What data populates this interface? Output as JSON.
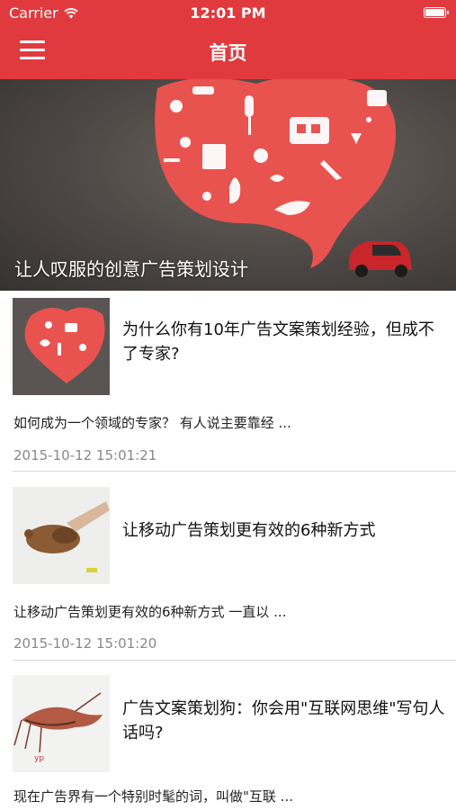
{
  "status_bar": {
    "carrier": "Carrier",
    "time": "12:01 PM",
    "icons": [
      "wifi-icon",
      "battery-icon"
    ]
  },
  "nav": {
    "title": "首页",
    "menu_icon": "hamburger-menu-icon"
  },
  "hero": {
    "caption": "让人叹服的创意广告策划设计"
  },
  "articles": [
    {
      "title": "为什么你有10年广告文案策划经验，但成不了专家?",
      "summary": "如何成为一个领域的专家？ 有人说主要靠经 ...",
      "date": "2015-10-12 15:01:21"
    },
    {
      "title": "让移动广告策划更有效的6种新方式",
      "summary": "让移动广告策划更有效的6种新方式 一直以 ...",
      "date": "2015-10-12 15:01:20"
    },
    {
      "title": "广告文案策划狗：你会用\"互联网思维\"写句人话吗?",
      "summary": "现在广告界有一个特别时髦的词，叫做\"互联 ...",
      "date": ""
    }
  ],
  "colors": {
    "brand": "#e03a3e",
    "date_text": "#888888",
    "divider": "#d8d8d8"
  }
}
